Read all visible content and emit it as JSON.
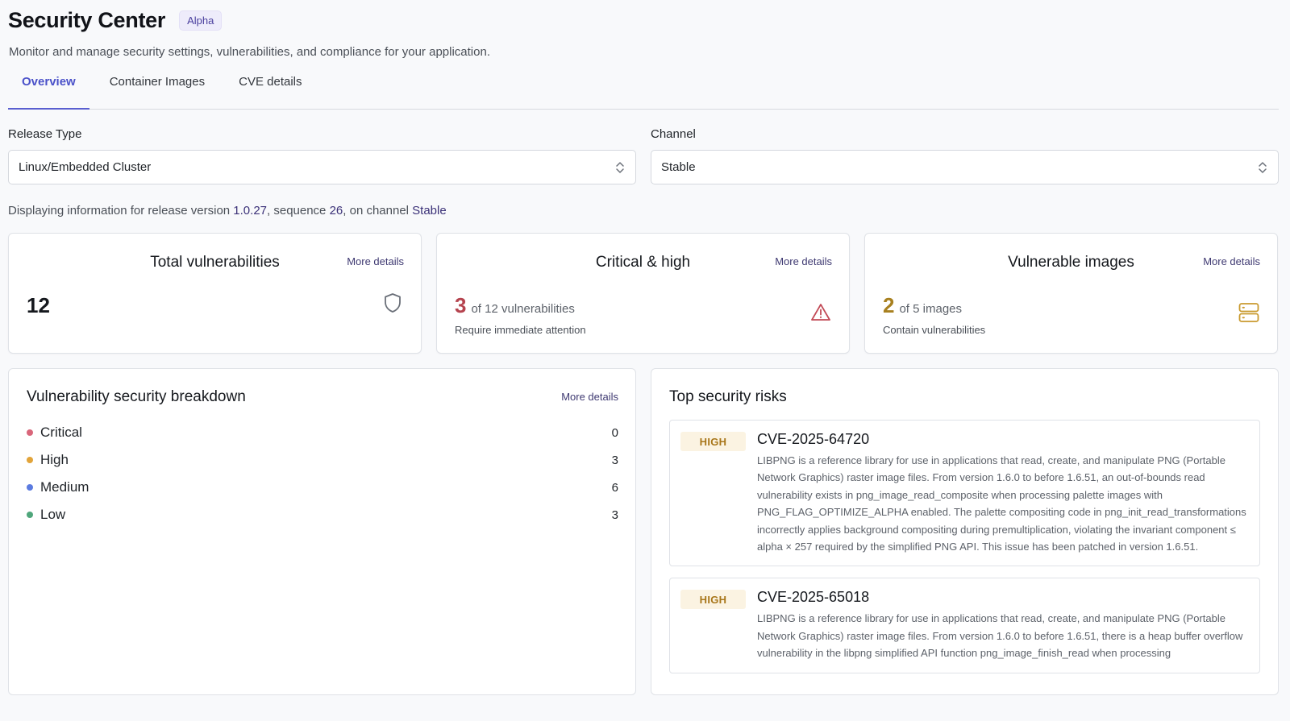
{
  "header": {
    "title": "Security Center",
    "badge": "Alpha",
    "subtitle": "Monitor and manage security settings, vulnerabilities, and compliance for your application."
  },
  "tabs": [
    {
      "label": "Overview",
      "active": true
    },
    {
      "label": "Container Images",
      "active": false
    },
    {
      "label": "CVE details",
      "active": false
    }
  ],
  "filters": {
    "release_type": {
      "label": "Release Type",
      "value": "Linux/Embedded Cluster"
    },
    "channel": {
      "label": "Channel",
      "value": "Stable"
    }
  },
  "info": {
    "prefix": "Displaying information for release version ",
    "version": "1.0.27",
    "mid1": ", sequence ",
    "sequence": "26",
    "mid2": ", on channel ",
    "channel": "Stable"
  },
  "stats": {
    "total": {
      "title": "Total vulnerabilities",
      "link": "More details",
      "value": "12",
      "icon": "shield-icon"
    },
    "critical_high": {
      "title": "Critical & high",
      "link": "More details",
      "value": "3",
      "of_text": "of 12 vulnerabilities",
      "sub": "Require immediate attention",
      "icon": "warning-triangle-icon",
      "color": "#b5434e"
    },
    "images": {
      "title": "Vulnerable images",
      "link": "More details",
      "value": "2",
      "of_text": "of 5 images",
      "sub": "Contain vulnerabilities",
      "icon": "server-icon",
      "color": "#a8801f"
    }
  },
  "breakdown": {
    "title": "Vulnerability security breakdown",
    "link": "More details",
    "items": [
      {
        "label": "Critical",
        "count": "0",
        "color": "#d9667a"
      },
      {
        "label": "High",
        "count": "3",
        "color": "#e2a43a"
      },
      {
        "label": "Medium",
        "count": "6",
        "color": "#5b7be0"
      },
      {
        "label": "Low",
        "count": "3",
        "color": "#4fa67b"
      }
    ]
  },
  "risks": {
    "title": "Top security risks",
    "items": [
      {
        "severity": "HIGH",
        "id": "CVE-2025-64720",
        "description": "LIBPNG is a reference library for use in applications that read, create, and manipulate PNG (Portable Network Graphics) raster image files. From version 1.6.0 to before 1.6.51, an out-of-bounds read vulnerability exists in png_image_read_composite when processing palette images with PNG_FLAG_OPTIMIZE_ALPHA enabled. The palette compositing code in png_init_read_transformations incorrectly applies background compositing during premultiplication, violating the invariant component ≤ alpha × 257 required by the simplified PNG API. This issue has been patched in version 1.6.51."
      },
      {
        "severity": "HIGH",
        "id": "CVE-2025-65018",
        "description": "LIBPNG is a reference library for use in applications that read, create, and manipulate PNG (Portable Network Graphics) raster image files. From version 1.6.0 to before 1.6.51, there is a heap buffer overflow vulnerability in the libpng simplified API function png_image_finish_read when processing"
      }
    ]
  }
}
